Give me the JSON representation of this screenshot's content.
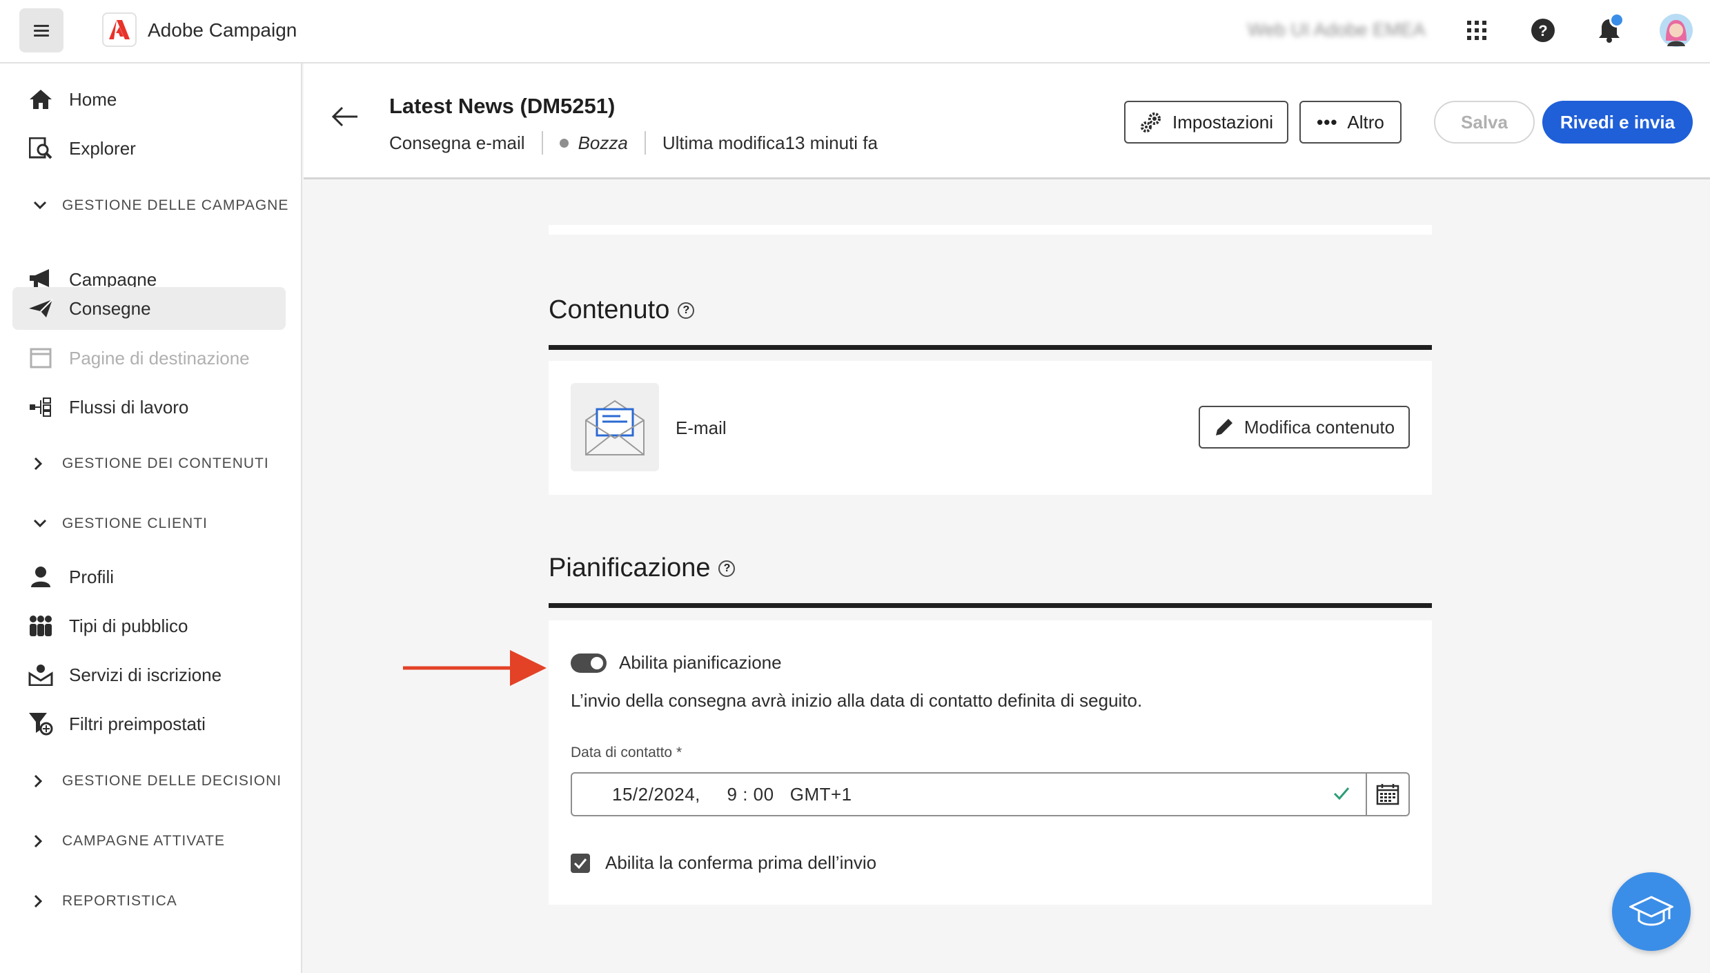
{
  "app": {
    "title": "Adobe Campaign",
    "org_name": "Web UI Adobe EMEA"
  },
  "sidebar": {
    "items": [
      {
        "label": "Home",
        "icon": "home-icon"
      },
      {
        "label": "Explorer",
        "icon": "explorer-icon"
      },
      {
        "label": "Campagne",
        "icon": "megaphone-icon"
      },
      {
        "label": "Consegne",
        "icon": "paper-plane-icon",
        "active": true
      },
      {
        "label": "Pagine di destinazione",
        "icon": "landing-page-icon",
        "disabled": true
      },
      {
        "label": "Flussi di lavoro",
        "icon": "workflow-icon"
      },
      {
        "label": "Profili",
        "icon": "user-icon"
      },
      {
        "label": "Tipi di pubblico",
        "icon": "audience-icon"
      },
      {
        "label": "Servizi di iscrizione",
        "icon": "subscription-icon"
      },
      {
        "label": "Filtri preimpostati",
        "icon": "filter-icon"
      }
    ],
    "sections": [
      {
        "label": "GESTIONE DELLE CAMPAGNE",
        "expanded": true
      },
      {
        "label": "GESTIONE DEI CONTENUTI",
        "expanded": false
      },
      {
        "label": "GESTIONE CLIENTI",
        "expanded": true
      },
      {
        "label": "GESTIONE DELLE DECISIONI",
        "expanded": false
      },
      {
        "label": "CAMPAGNE ATTIVATE",
        "expanded": false
      },
      {
        "label": "REPORTISTICA",
        "expanded": false
      }
    ]
  },
  "header": {
    "title": "Latest News (DM5251)",
    "type": "Consegna e-mail",
    "status": "Bozza",
    "last_modified": "Ultima modifica13 minuti fa",
    "settings_label": "Impostazioni",
    "more_label": "Altro",
    "save_label": "Salva",
    "review_label": "Rivedi e invia"
  },
  "content": {
    "title": "Contenuto",
    "channel_label": "E-mail",
    "edit_label": "Modifica contenuto"
  },
  "scheduling": {
    "title": "Pianificazione",
    "toggle_label": "Abilita pianificazione",
    "toggle_on": true,
    "description": "L’invio della consegna avrà inizio alla data di contatto definita di seguito.",
    "date_label": "Data di contatto",
    "date_value": "15/2/2024,     9 : 00   GMT+1",
    "confirm_label": "Abilita la conferma prima dell’invio",
    "confirm_checked": true
  },
  "colors": {
    "primary": "#1f5fd8",
    "accent": "#3b8ee8",
    "arrow": "#e34226",
    "check": "#2d9d78"
  }
}
